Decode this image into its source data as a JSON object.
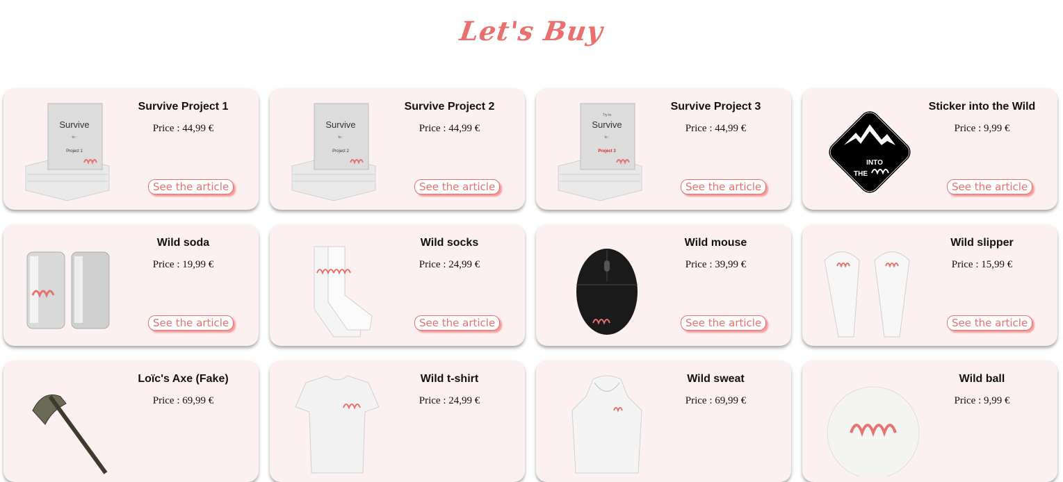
{
  "page": {
    "title": "Let's Buy"
  },
  "button_label": "See the article",
  "accent_color": "#e8706e",
  "products": [
    {
      "name": "Survive Project 1",
      "price": "Price : 44,99 €",
      "image": "book-stack-icon",
      "book_top": "",
      "book_bottom": "Project 1"
    },
    {
      "name": "Survive Project 2",
      "price": "Price : 44,99 €",
      "image": "book-stack-icon",
      "book_top": "",
      "book_bottom": "Project 2"
    },
    {
      "name": "Survive Project 3",
      "price": "Price : 44,99 €",
      "image": "book-stack-icon",
      "book_top": "Try to",
      "book_bottom": "Project 3"
    },
    {
      "name": "Sticker into the Wild",
      "price": "Price : 9,99 €",
      "image": "mountain-sticker-icon",
      "sticker_line1": "INTO",
      "sticker_line2": "THE"
    },
    {
      "name": "Wild soda",
      "price": "Price : 19,99 €",
      "image": "soda-cans-icon"
    },
    {
      "name": "Wild socks",
      "price": "Price : 24,99 €",
      "image": "socks-icon"
    },
    {
      "name": "Wild mouse",
      "price": "Price : 39,99 €",
      "image": "mouse-icon"
    },
    {
      "name": "Wild slipper",
      "price": "Price : 15,99 €",
      "image": "slippers-icon"
    },
    {
      "name": "Loïc's Axe (Fake)",
      "price": "Price : 69,99 €",
      "image": "axe-icon"
    },
    {
      "name": "Wild t-shirt",
      "price": "Price : 24,99 €",
      "image": "tshirt-icon"
    },
    {
      "name": "Wild sweat",
      "price": "Price : 69,99 €",
      "image": "hoodie-icon"
    },
    {
      "name": "Wild ball",
      "price": "Price : 9,99 €",
      "image": "ball-icon"
    }
  ],
  "book_cover_word": "Survive",
  "book_cover_to": "to :"
}
